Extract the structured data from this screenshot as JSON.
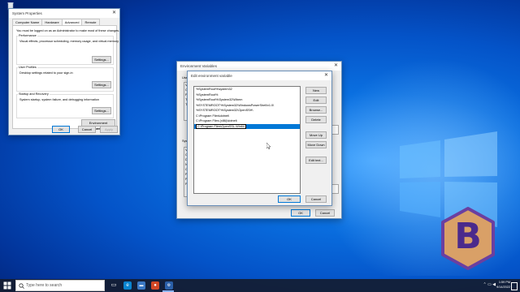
{
  "desktop_icon": {
    "name": "Recycle Bin"
  },
  "system_properties": {
    "title": "System Properties",
    "tabs": [
      "Computer Name",
      "Hardware",
      "Advanced",
      "Remote"
    ],
    "active_tab": "Advanced",
    "admin_note": "You must be logged on as an Administrator to make most of these changes.",
    "performance": {
      "title": "Performance",
      "desc": "Visual effects, processor scheduling, memory usage, and virtual memory",
      "button": "Settings..."
    },
    "user_profiles": {
      "title": "User Profiles",
      "desc": "Desktop settings related to your sign-in",
      "button": "Settings..."
    },
    "startup_recovery": {
      "title": "Startup and Recovery",
      "desc": "System startup, system failure, and debugging information",
      "button": "Settings..."
    },
    "env_button": "Environment Variables...",
    "ok": "OK",
    "cancel": "Cancel",
    "apply": "Apply"
  },
  "environment_variables": {
    "title": "Environment Variables",
    "user_label": "User",
    "system_label": "System",
    "ok": "OK",
    "cancel": "Cancel"
  },
  "edit_env": {
    "title": "Edit environment variable",
    "items": [
      "%SystemRoot%\\system32",
      "%SystemRoot%",
      "%SystemRoot%\\System32\\Wbem",
      "%SYSTEMROOT%\\System32\\WindowsPowerShell\\v1.0\\",
      "%SYSTEMROOT%\\System32\\OpenSSH\\",
      "C:\\Program Files\\dotnet\\",
      "C:\\Program Files (x86)\\dotnet\\",
      "C:\\Program Files\\OpenSSL-Win64"
    ],
    "selected_index": 7,
    "buttons": {
      "new": "New",
      "edit": "Edit",
      "browse": "Browse...",
      "delete": "Delete",
      "move_up": "Move Up",
      "move_down": "Move Down",
      "edit_text": "Edit text..."
    },
    "ok": "OK",
    "cancel": "Cancel"
  },
  "taskbar": {
    "search_placeholder": "Type here to search",
    "time": "1:59 PM",
    "date": "9/14/2022"
  },
  "logo_letter": "B",
  "colors": {
    "accent": "#0078d7",
    "badge_fill": "#d9a067",
    "badge_border": "#6b3fa0"
  }
}
